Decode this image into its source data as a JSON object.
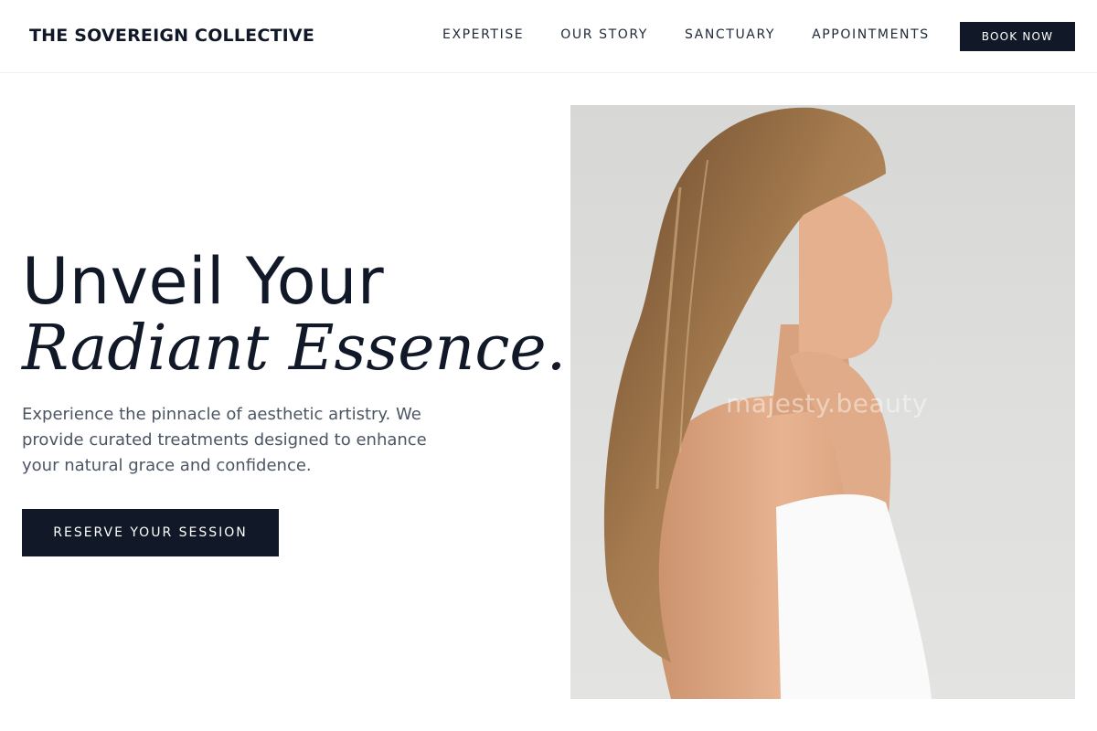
{
  "header": {
    "brand": "THE SOVEREIGN COLLECTIVE",
    "nav": [
      {
        "label": "EXPERTISE"
      },
      {
        "label": "OUR STORY"
      },
      {
        "label": "SANCTUARY"
      },
      {
        "label": "APPOINTMENTS"
      }
    ],
    "book_label": "BOOK NOW"
  },
  "hero": {
    "title_line1": "Unveil Your",
    "title_line2": "Radiant Essence.",
    "description": "Experience the pinnacle of aesthetic artistry. We provide curated treatments designed to enhance your natural grace and confidence.",
    "cta_label": "RESERVE YOUR SESSION",
    "image": {
      "watermark": "majesty.beauty",
      "subject": "woman-profile-photo"
    }
  },
  "colors": {
    "primary": "#111827",
    "text_muted": "#4b5563",
    "background": "#ffffff",
    "photo_background": "#dcdcda"
  }
}
